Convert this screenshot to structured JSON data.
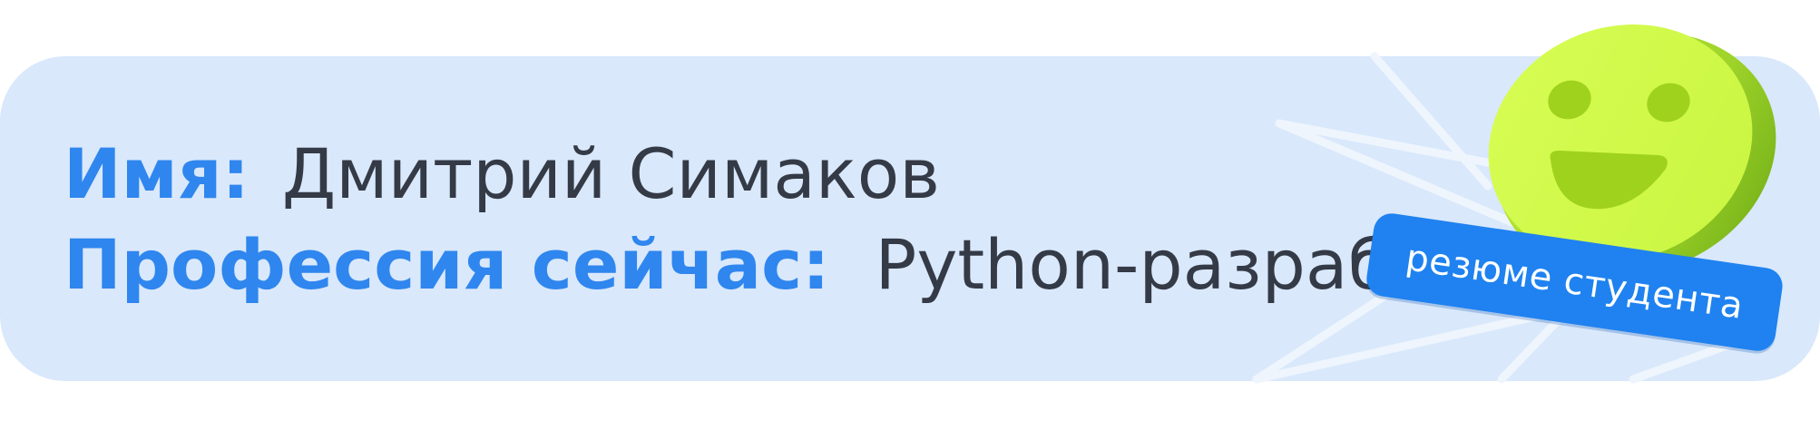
{
  "profile": {
    "name_label": "Имя:",
    "name_value": "Дмитрий Симаков",
    "profession_label": "Профессия сейчас:",
    "profession_value": "Python-разработчик"
  },
  "badge": {
    "text": "резюме студента",
    "color": "#1f82f0"
  },
  "decor": {
    "mascot": "smiley-face-icon",
    "mascot_color": "#d4fb4c",
    "background_color": "#d9e8fb",
    "label_color": "#2f86ee",
    "value_color": "#343a46"
  }
}
